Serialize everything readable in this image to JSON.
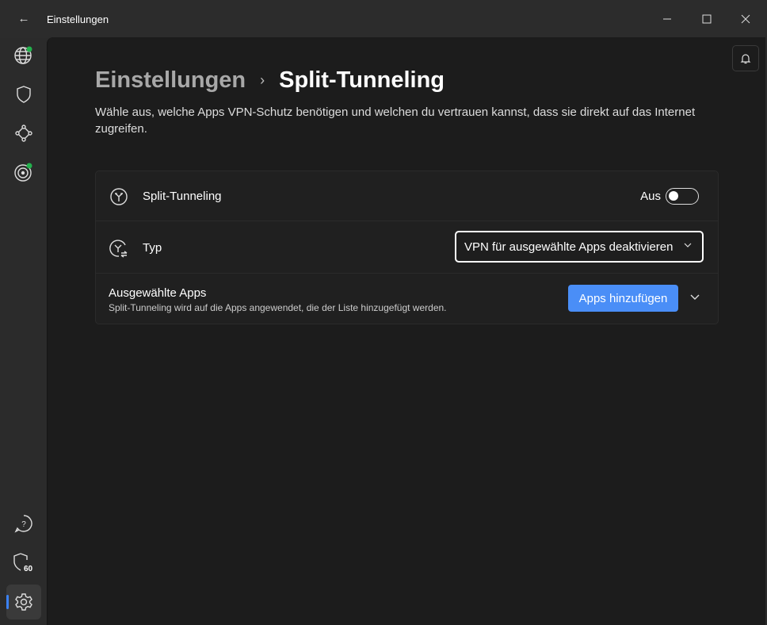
{
  "window": {
    "title": "Einstellungen"
  },
  "breadcrumb": {
    "parent": "Einstellungen",
    "current": "Split-Tunneling",
    "separator": "›"
  },
  "description": "Wähle aus, welche Apps VPN-Schutz benötigen und welchen du vertrauen kannst, dass sie direkt auf das Internet zugreifen.",
  "settings": {
    "split_tunneling": {
      "label": "Split-Tunneling",
      "state_label": "Aus",
      "enabled": false
    },
    "type": {
      "label": "Typ",
      "selected": "VPN für ausgewählte Apps deaktivieren"
    },
    "apps": {
      "title": "Ausgewählte Apps",
      "subtitle": "Split-Tunneling wird auf die Apps angewendet, die der Liste hinzugefügt werden.",
      "add_button": "Apps hinzufügen"
    }
  },
  "sidebar": {
    "badge_number": "60"
  },
  "colors": {
    "accent": "#4a8ef7",
    "status_dot": "#22b14c"
  }
}
